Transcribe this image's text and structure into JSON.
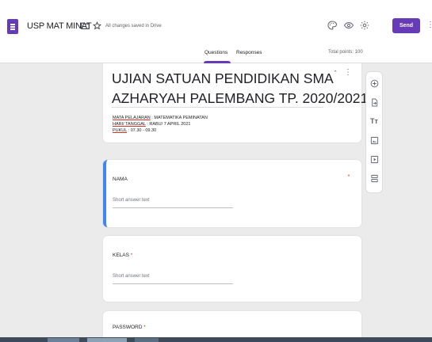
{
  "header": {
    "doc_title": "USP MAT MINAT",
    "save_status": "All changes saved in Drive",
    "send_label": "Send"
  },
  "tabs": [
    {
      "label": "Questions",
      "active": true
    },
    {
      "label": "Responses",
      "active": false
    }
  ],
  "total_points": "Total points: 100",
  "form": {
    "title_line1": "UJIAN SATUAN PENDIDIKAN SMA",
    "title_line2": "AZHARYAH PALEMBANG TP. 2020/2021",
    "description": [
      {
        "key": "MATA PELAJARAN",
        "rest": " : MATEMATIKA PEMINATAN"
      },
      {
        "key": "HARI/ TANGGAL",
        "rest": " : RABU/ 7 APRIL 2021"
      },
      {
        "key": "PUKUL",
        "rest": " : 07.30 - 09.30"
      }
    ]
  },
  "questions": [
    {
      "title": "NAMA",
      "required": true,
      "placeholder": "Short answer text"
    },
    {
      "title": "KELAS",
      "required": true,
      "placeholder": "Short answer text"
    },
    {
      "title": "PASSWORD",
      "required": true
    }
  ],
  "icons": {
    "header": [
      "folder-icon",
      "star-icon",
      "palette-icon",
      "eye-icon",
      "settings-icon",
      "more-vert-icon"
    ],
    "toolbar": [
      "add-question-icon",
      "import-questions-icon",
      "add-title-icon",
      "add-image-icon",
      "add-video-icon",
      "add-section-icon"
    ]
  },
  "colors": {
    "accent": "#673ab7",
    "active_border": "#4285f4",
    "required": "#d93025",
    "canvas": "#ebebeb"
  }
}
